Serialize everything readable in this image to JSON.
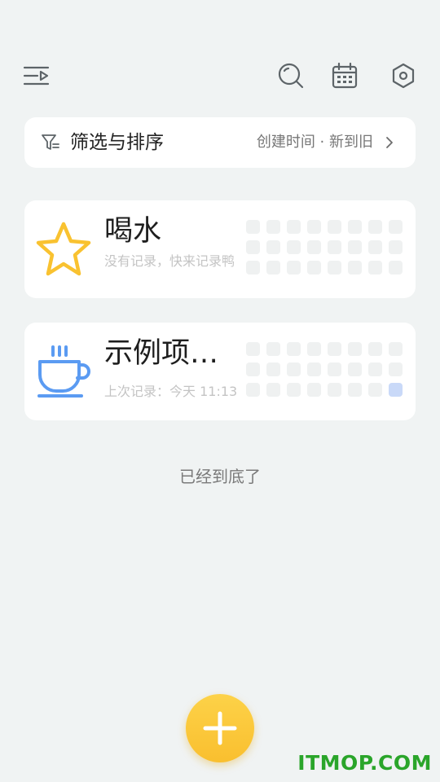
{
  "toolbar": {
    "menu_icon": "menu-list-icon",
    "search_icon": "search-icon",
    "calendar_icon": "calendar-icon",
    "settings_icon": "hexagon-settings-icon"
  },
  "filter": {
    "icon": "funnel-icon",
    "label": "筛选与排序",
    "value": "创建时间 · 新到旧",
    "chevron": "chevron-right-icon"
  },
  "items": [
    {
      "title": "喝水",
      "subtitle": "没有记录，快来记录鸭",
      "icon": "star-icon",
      "icon_color": "#f9c230",
      "grid_rows": 3,
      "grid_cols": 8,
      "active_cells": []
    },
    {
      "title": "示例项…",
      "subtitle": "上次记录：今天 11:13",
      "icon": "coffee-cup-icon",
      "icon_color": "#5b9bf2",
      "grid_rows": 3,
      "grid_cols": 8,
      "active_cells": [
        23
      ]
    }
  ],
  "footer": {
    "text": "已经到底了"
  },
  "fab": {
    "icon": "plus-icon",
    "color": "#fbc93b"
  },
  "watermark": {
    "text": "ITMOP.COM"
  }
}
